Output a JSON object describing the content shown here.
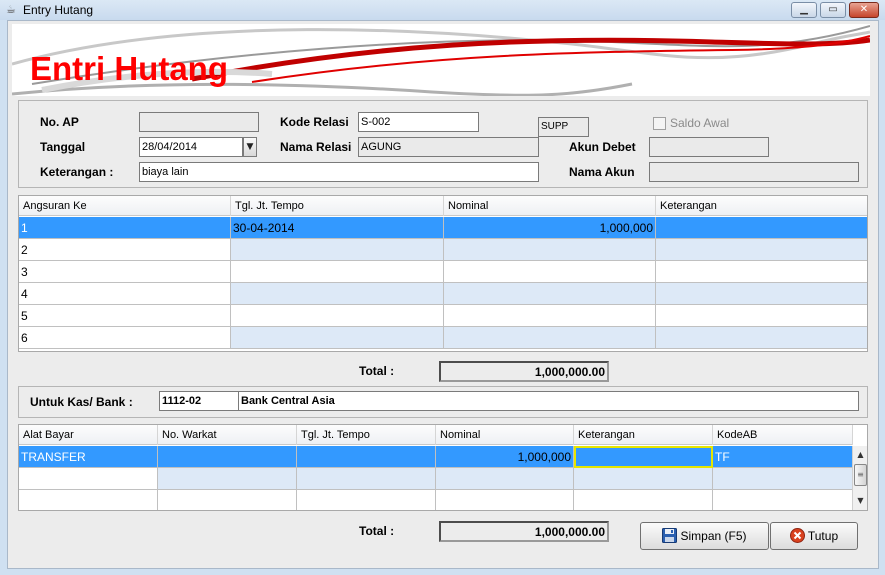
{
  "window": {
    "title": "Entry Hutang",
    "minimize_glyph": "▁",
    "restore_glyph": "▭",
    "close_glyph": "✕"
  },
  "banner": {
    "title": "Entri Hutang"
  },
  "header_form": {
    "no_ap": {
      "label": "No. AP",
      "value": ""
    },
    "tanggal": {
      "label": "Tanggal",
      "value": "28/04/2014"
    },
    "keterangan": {
      "label": "Keterangan :",
      "value": "biaya lain"
    },
    "kode_relasi": {
      "label": "Kode Relasi",
      "value": "S-002"
    },
    "nama_relasi": {
      "label": "Nama Relasi",
      "value": "AGUNG"
    },
    "relasi_type": "SUPP",
    "saldo_awal": {
      "label": "Saldo Awal",
      "checked": false
    },
    "akun_debet": {
      "label": "Akun Debet",
      "value": ""
    },
    "nama_akun": {
      "label": "Nama Akun",
      "value": ""
    }
  },
  "installments": {
    "columns": [
      "Angsuran Ke",
      "Tgl. Jt. Tempo",
      "Nominal",
      "Keterangan"
    ],
    "rows": [
      [
        "1",
        "30-04-2014",
        "1,000,000",
        ""
      ],
      [
        "2",
        "",
        "",
        ""
      ],
      [
        "3",
        "",
        "",
        ""
      ],
      [
        "4",
        "",
        "",
        ""
      ],
      [
        "5",
        "",
        "",
        ""
      ],
      [
        "6",
        "",
        "",
        ""
      ]
    ],
    "selected_row": 0,
    "total_label": "Total :",
    "total_value": "1,000,000.00"
  },
  "kas_bank": {
    "label": "Untuk Kas/ Bank :",
    "code": "1112-02",
    "name": "Bank Central Asia"
  },
  "payments": {
    "columns": [
      "Alat Bayar",
      "No. Warkat",
      "Tgl. Jt. Tempo",
      "Nominal",
      "Keterangan",
      "KodeAB"
    ],
    "rows": [
      [
        "TRANSFER",
        "",
        "",
        "1,000,000",
        "",
        "TF"
      ],
      [
        "",
        "",
        "",
        "",
        "",
        ""
      ],
      [
        "",
        "",
        "",
        "",
        "",
        ""
      ]
    ],
    "selected_row": 0,
    "total_label": "Total :",
    "total_value": "1,000,000.00"
  },
  "buttons": {
    "save": "Simpan (F5)",
    "close": "Tutup"
  },
  "colors": {
    "banner_red": "#ff0000",
    "selection_blue": "#3399ff",
    "alt_row": "#dde9f7"
  }
}
